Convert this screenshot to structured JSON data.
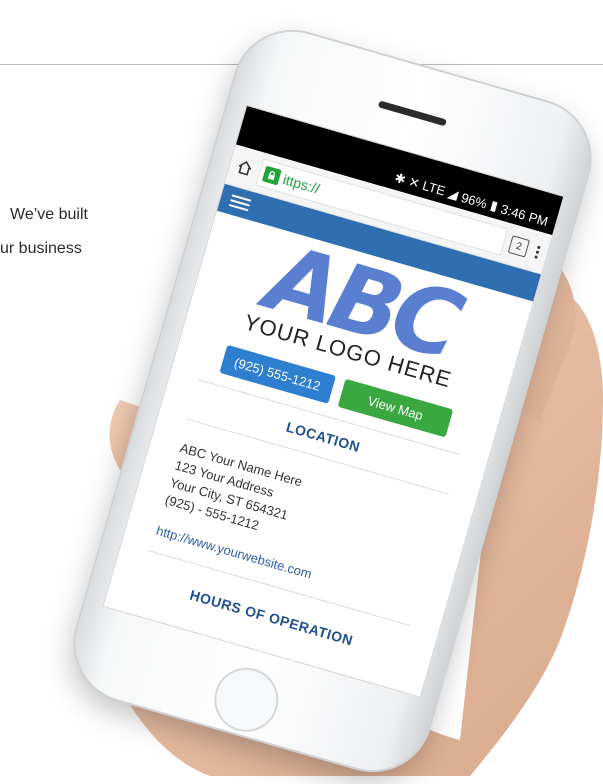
{
  "background_text": {
    "line1": "We’ve built",
    "line2": "ur business"
  },
  "phone": {
    "status_bar": {
      "icons": "✱ ✕ LTE ◢",
      "battery": "96%",
      "time": "3:46 PM"
    },
    "browser": {
      "url": "ittps://",
      "tabs_count": "2"
    },
    "site": {
      "logo_text": "ABC",
      "logo_tagline": "YOUR LOGO HERE",
      "phone_button": "(925) 555-1212",
      "map_button": "View Map",
      "location_title": "LOCATION",
      "address_lines": [
        "ABC Your Name Here",
        "123 Your Address",
        "Your City, ST 654321",
        "(925) - 555-1212"
      ],
      "website": "http://www.yourwebsite.com",
      "hours_title": "HOURS OF OPERATION"
    }
  },
  "colors": {
    "nav_blue": "#2f6fb1",
    "logo_blue": "#5a7fd0",
    "button_blue": "#2f7fd0",
    "button_green": "#3aa840",
    "lock_green": "#21a33a"
  }
}
